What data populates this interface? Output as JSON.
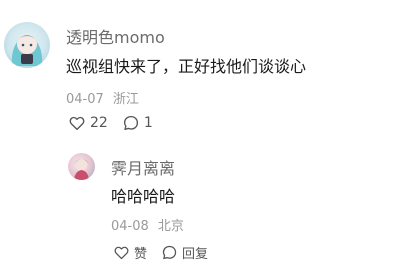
{
  "comment": {
    "username": "透明色momo",
    "text": "巡视组快来了，正好找他们谈谈心",
    "date": "04-07",
    "location": "浙江",
    "like_count": "22",
    "reply_count": "1",
    "avatar_icon": "anime-avatar-icon"
  },
  "reply": {
    "username": "霁月离离",
    "text": "哈哈哈哈",
    "date": "04-08",
    "location": "北京",
    "like_label": "赞",
    "reply_label": "回复",
    "avatar_icon": "anime-avatar-icon"
  },
  "colors": {
    "username": "#6b6b6b",
    "text": "#1a1a1a",
    "meta": "#9a9a9a"
  }
}
